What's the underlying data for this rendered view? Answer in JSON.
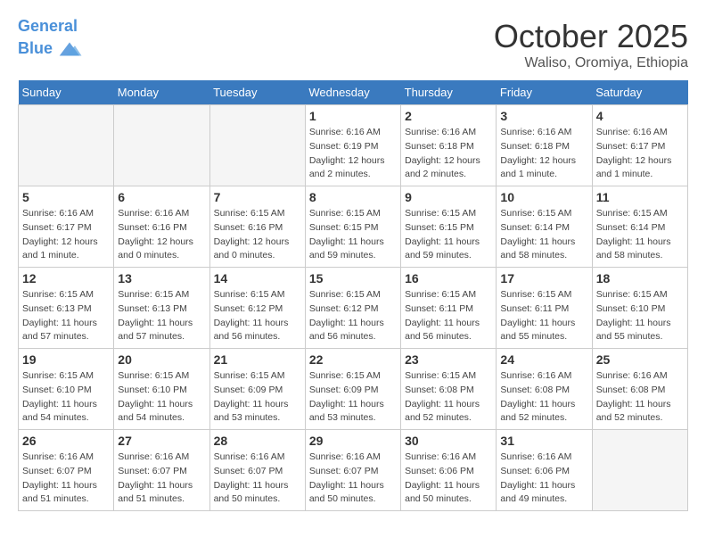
{
  "logo": {
    "line1": "General",
    "line2": "Blue"
  },
  "title": "October 2025",
  "subtitle": "Waliso, Oromiya, Ethiopia",
  "days_of_week": [
    "Sunday",
    "Monday",
    "Tuesday",
    "Wednesday",
    "Thursday",
    "Friday",
    "Saturday"
  ],
  "weeks": [
    [
      {
        "day": "",
        "info": ""
      },
      {
        "day": "",
        "info": ""
      },
      {
        "day": "",
        "info": ""
      },
      {
        "day": "1",
        "info": "Sunrise: 6:16 AM\nSunset: 6:19 PM\nDaylight: 12 hours\nand 2 minutes."
      },
      {
        "day": "2",
        "info": "Sunrise: 6:16 AM\nSunset: 6:18 PM\nDaylight: 12 hours\nand 2 minutes."
      },
      {
        "day": "3",
        "info": "Sunrise: 6:16 AM\nSunset: 6:18 PM\nDaylight: 12 hours\nand 1 minute."
      },
      {
        "day": "4",
        "info": "Sunrise: 6:16 AM\nSunset: 6:17 PM\nDaylight: 12 hours\nand 1 minute."
      }
    ],
    [
      {
        "day": "5",
        "info": "Sunrise: 6:16 AM\nSunset: 6:17 PM\nDaylight: 12 hours\nand 1 minute."
      },
      {
        "day": "6",
        "info": "Sunrise: 6:16 AM\nSunset: 6:16 PM\nDaylight: 12 hours\nand 0 minutes."
      },
      {
        "day": "7",
        "info": "Sunrise: 6:15 AM\nSunset: 6:16 PM\nDaylight: 12 hours\nand 0 minutes."
      },
      {
        "day": "8",
        "info": "Sunrise: 6:15 AM\nSunset: 6:15 PM\nDaylight: 11 hours\nand 59 minutes."
      },
      {
        "day": "9",
        "info": "Sunrise: 6:15 AM\nSunset: 6:15 PM\nDaylight: 11 hours\nand 59 minutes."
      },
      {
        "day": "10",
        "info": "Sunrise: 6:15 AM\nSunset: 6:14 PM\nDaylight: 11 hours\nand 58 minutes."
      },
      {
        "day": "11",
        "info": "Sunrise: 6:15 AM\nSunset: 6:14 PM\nDaylight: 11 hours\nand 58 minutes."
      }
    ],
    [
      {
        "day": "12",
        "info": "Sunrise: 6:15 AM\nSunset: 6:13 PM\nDaylight: 11 hours\nand 57 minutes."
      },
      {
        "day": "13",
        "info": "Sunrise: 6:15 AM\nSunset: 6:13 PM\nDaylight: 11 hours\nand 57 minutes."
      },
      {
        "day": "14",
        "info": "Sunrise: 6:15 AM\nSunset: 6:12 PM\nDaylight: 11 hours\nand 56 minutes."
      },
      {
        "day": "15",
        "info": "Sunrise: 6:15 AM\nSunset: 6:12 PM\nDaylight: 11 hours\nand 56 minutes."
      },
      {
        "day": "16",
        "info": "Sunrise: 6:15 AM\nSunset: 6:11 PM\nDaylight: 11 hours\nand 56 minutes."
      },
      {
        "day": "17",
        "info": "Sunrise: 6:15 AM\nSunset: 6:11 PM\nDaylight: 11 hours\nand 55 minutes."
      },
      {
        "day": "18",
        "info": "Sunrise: 6:15 AM\nSunset: 6:10 PM\nDaylight: 11 hours\nand 55 minutes."
      }
    ],
    [
      {
        "day": "19",
        "info": "Sunrise: 6:15 AM\nSunset: 6:10 PM\nDaylight: 11 hours\nand 54 minutes."
      },
      {
        "day": "20",
        "info": "Sunrise: 6:15 AM\nSunset: 6:10 PM\nDaylight: 11 hours\nand 54 minutes."
      },
      {
        "day": "21",
        "info": "Sunrise: 6:15 AM\nSunset: 6:09 PM\nDaylight: 11 hours\nand 53 minutes."
      },
      {
        "day": "22",
        "info": "Sunrise: 6:15 AM\nSunset: 6:09 PM\nDaylight: 11 hours\nand 53 minutes."
      },
      {
        "day": "23",
        "info": "Sunrise: 6:15 AM\nSunset: 6:08 PM\nDaylight: 11 hours\nand 52 minutes."
      },
      {
        "day": "24",
        "info": "Sunrise: 6:16 AM\nSunset: 6:08 PM\nDaylight: 11 hours\nand 52 minutes."
      },
      {
        "day": "25",
        "info": "Sunrise: 6:16 AM\nSunset: 6:08 PM\nDaylight: 11 hours\nand 52 minutes."
      }
    ],
    [
      {
        "day": "26",
        "info": "Sunrise: 6:16 AM\nSunset: 6:07 PM\nDaylight: 11 hours\nand 51 minutes."
      },
      {
        "day": "27",
        "info": "Sunrise: 6:16 AM\nSunset: 6:07 PM\nDaylight: 11 hours\nand 51 minutes."
      },
      {
        "day": "28",
        "info": "Sunrise: 6:16 AM\nSunset: 6:07 PM\nDaylight: 11 hours\nand 50 minutes."
      },
      {
        "day": "29",
        "info": "Sunrise: 6:16 AM\nSunset: 6:07 PM\nDaylight: 11 hours\nand 50 minutes."
      },
      {
        "day": "30",
        "info": "Sunrise: 6:16 AM\nSunset: 6:06 PM\nDaylight: 11 hours\nand 50 minutes."
      },
      {
        "day": "31",
        "info": "Sunrise: 6:16 AM\nSunset: 6:06 PM\nDaylight: 11 hours\nand 49 minutes."
      },
      {
        "day": "",
        "info": ""
      }
    ]
  ]
}
